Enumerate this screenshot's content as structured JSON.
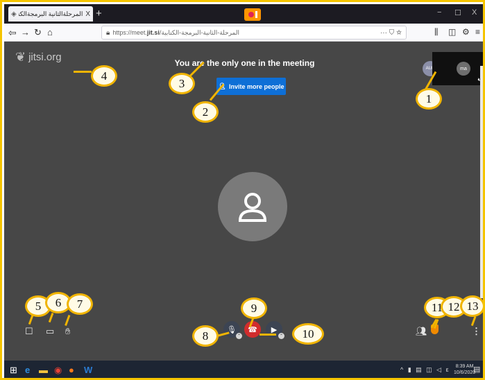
{
  "browser": {
    "tab_title": "المرحلةالثانية البرمجةالكتابية | meet",
    "tab_close": "X",
    "new_tab": "+",
    "url_prefix": "https://meet.",
    "url_domain": "jit.si",
    "url_path": "/المرحلة-الثانية-البرمجة-الكتابية",
    "page_actions": "··· ⛉ ☆",
    "window_controls": [
      "−",
      "☐",
      "X"
    ]
  },
  "meeting": {
    "logo": "jitsi.org",
    "status_message": "You are the only one in the meeting",
    "invite_button": "Invite more people",
    "local_participant_initials": "ma",
    "audio_badge": "AUD"
  },
  "taskbar": {
    "time": "8:39 AM",
    "date": "10/6/2020"
  },
  "callouts": [
    "1",
    "2",
    "3",
    "4",
    "5",
    "6",
    "7",
    "8",
    "9",
    "10",
    "11",
    "12",
    "13"
  ],
  "colors": {
    "frame_border": "#f5c400",
    "meeting_bg": "#474747",
    "invite_blue": "#0e6fd6",
    "hangup_red": "#d12d2d",
    "callout_yellow": "#f0b400"
  },
  "icons": [
    "back-icon",
    "forward-icon",
    "reload-icon",
    "home-icon",
    "lock-icon",
    "chat-icon",
    "screen-share-icon",
    "raise-hand-icon",
    "mic-icon",
    "hangup-icon",
    "camera-icon",
    "invite-icon",
    "security-shield-icon",
    "more-icon",
    "windows-start-icon",
    "edge-icon",
    "file-explorer-icon",
    "chrome-icon",
    "firefox-icon",
    "word-icon"
  ]
}
